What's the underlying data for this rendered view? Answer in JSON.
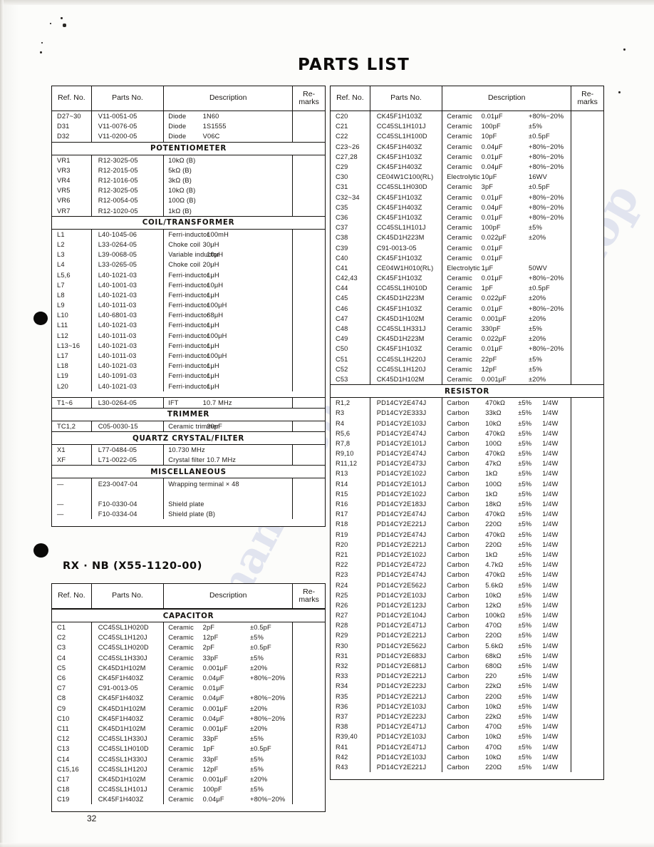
{
  "document": {
    "title": "PARTS LIST",
    "page_number": "32",
    "subtitle": "RX · NB  (X55-1120-00)"
  },
  "columns": {
    "ref": "Ref. No.",
    "part": "Parts No.",
    "desc": "Description",
    "remarks": "Re-\nmarks",
    "remarks_line1": "Re-",
    "remarks_line2": "marks"
  },
  "sections": {
    "potentiometer": "POTENTIOMETER",
    "coil_transformer": "COIL/TRANSFORMER",
    "trimmer": "TRIMMER",
    "quartz": "QUARTZ CRYSTAL/FILTER",
    "misc": "MISCELLANEOUS",
    "capacitor": "CAPACITOR",
    "resistor": "RESISTOR"
  },
  "left_table_1": {
    "diodes": [
      {
        "ref": "D27~30",
        "part": "V11-0051-05",
        "d1": "Diode",
        "d2": "1N60",
        "d3": "",
        "rem": ""
      },
      {
        "ref": "D31",
        "part": "V11-0076-05",
        "d1": "Diode",
        "d2": "1S1555",
        "d3": "",
        "rem": ""
      },
      {
        "ref": "D32",
        "part": "V11-0200-05",
        "d1": "Diode",
        "d2": "V06C",
        "d3": "",
        "rem": ""
      }
    ],
    "potentiometers": [
      {
        "ref": "VR1",
        "part": "R12-3025-05",
        "d1": "10kΩ (B)",
        "d2": "",
        "d3": "",
        "rem": ""
      },
      {
        "ref": "VR3",
        "part": "R12-2015-05",
        "d1": "5kΩ (B)",
        "d2": "",
        "d3": "",
        "rem": ""
      },
      {
        "ref": "VR4",
        "part": "R12-1016-05",
        "d1": "3kΩ (B)",
        "d2": "",
        "d3": "",
        "rem": ""
      },
      {
        "ref": "VR5",
        "part": "R12-3025-05",
        "d1": "10kΩ (B)",
        "d2": "",
        "d3": "",
        "rem": ""
      },
      {
        "ref": "VR6",
        "part": "R12-0054-05",
        "d1": "100Ω (B)",
        "d2": "",
        "d3": "",
        "rem": ""
      },
      {
        "ref": "VR7",
        "part": "R12-1020-05",
        "d1": "1kΩ (B)",
        "d2": "",
        "d3": "",
        "rem": ""
      }
    ],
    "coils": [
      {
        "ref": "L1",
        "part": "L40-1045-06",
        "d1": "Ferri-inductor",
        "d2": "100mH",
        "d3": "",
        "rem": ""
      },
      {
        "ref": "L2",
        "part": "L33-0264-05",
        "d1": "Choke coil",
        "d2": "30μH",
        "d3": "",
        "rem": ""
      },
      {
        "ref": "L3",
        "part": "L39-0068-05",
        "d1": "Variable inductor",
        "d2": "10μH",
        "d3": "",
        "rem": ""
      },
      {
        "ref": "L4",
        "part": "L33-0265-05",
        "d1": "Choke coil",
        "d2": "20μH",
        "d3": "",
        "rem": ""
      },
      {
        "ref": "L5,6",
        "part": "L40-1021-03",
        "d1": "Ferri-inductor",
        "d2": "1μH",
        "d3": "",
        "rem": ""
      },
      {
        "ref": "L7",
        "part": "L40-1001-03",
        "d1": "Ferri-inductor",
        "d2": "10μH",
        "d3": "",
        "rem": ""
      },
      {
        "ref": "L8",
        "part": "L40-1021-03",
        "d1": "Ferri-inductor",
        "d2": "1μH",
        "d3": "",
        "rem": ""
      },
      {
        "ref": "L9",
        "part": "L40-1011-03",
        "d1": "Ferri-inductor",
        "d2": "100μH",
        "d3": "",
        "rem": ""
      },
      {
        "ref": "L10",
        "part": "L40-6801-03",
        "d1": "Ferri-inductor",
        "d2": "68μH",
        "d3": "",
        "rem": ""
      },
      {
        "ref": "L11",
        "part": "L40-1021-03",
        "d1": "Ferri-inductor",
        "d2": "1μH",
        "d3": "",
        "rem": ""
      },
      {
        "ref": "L12",
        "part": "L40-1011-03",
        "d1": "Ferri-inductor",
        "d2": "100μH",
        "d3": "",
        "rem": ""
      },
      {
        "ref": "L13~16",
        "part": "L40-1021-03",
        "d1": "Ferri-inductor",
        "d2": "1μH",
        "d3": "",
        "rem": ""
      },
      {
        "ref": "L17",
        "part": "L40-1011-03",
        "d1": "Ferri-inductor",
        "d2": "100μH",
        "d3": "",
        "rem": ""
      },
      {
        "ref": "L18",
        "part": "L40-1021-03",
        "d1": "Ferri-inductor",
        "d2": "1μH",
        "d3": "",
        "rem": ""
      },
      {
        "ref": "L19",
        "part": "L40-1091-03",
        "d1": "Ferri-inductor",
        "d2": "1μH",
        "d3": "",
        "rem": ""
      },
      {
        "ref": "L20",
        "part": "L40-1021-03",
        "d1": "Ferri-inductor",
        "d2": "1μH",
        "d3": "",
        "rem": ""
      }
    ],
    "ift": [
      {
        "ref": "T1~6",
        "part": "L30-0264-05",
        "d1": "IFT",
        "d2": "10.7 MHz",
        "d3": "",
        "rem": ""
      }
    ],
    "trimmers": [
      {
        "ref": "TC1,2",
        "part": "C05-0030-15",
        "d1": "Ceramic trimmer",
        "d2": "20pF",
        "d3": "",
        "rem": ""
      }
    ],
    "quartz": [
      {
        "ref": "X1",
        "part": "L77-0484-05",
        "d1": "10.730 MHz",
        "d2": "",
        "d3": "",
        "rem": ""
      },
      {
        "ref": "XF",
        "part": "L71-0022-05",
        "d1": "Crystal filter 10.7 MHz",
        "d2": "",
        "d3": "",
        "rem": ""
      }
    ],
    "misc": [
      {
        "ref": "—",
        "part": "E23-0047-04",
        "d1": "Wrapping terminal × 48",
        "d2": "",
        "d3": "",
        "rem": ""
      },
      {
        "ref": "",
        "part": "",
        "d1": "",
        "d2": "",
        "d3": "",
        "rem": ""
      },
      {
        "ref": "—",
        "part": "F10-0330-04",
        "d1": "Shield plate",
        "d2": "",
        "d3": "",
        "rem": ""
      },
      {
        "ref": "—",
        "part": "F10-0334-04",
        "d1": "Shield plate (B)",
        "d2": "",
        "d3": "",
        "rem": ""
      }
    ]
  },
  "left_table_2": {
    "capacitors": [
      {
        "ref": "C1",
        "part": "CC45SL1H020D",
        "d1": "Ceramic",
        "d2": "2pF",
        "d3": "±0.5pF",
        "rem": ""
      },
      {
        "ref": "C2",
        "part": "CC45SL1H120J",
        "d1": "Ceramic",
        "d2": "12pF",
        "d3": "±5%",
        "rem": ""
      },
      {
        "ref": "C3",
        "part": "CC45SL1H020D",
        "d1": "Ceramic",
        "d2": "2pF",
        "d3": "±0.5pF",
        "rem": ""
      },
      {
        "ref": "C4",
        "part": "CC45SL1H330J",
        "d1": "Ceramic",
        "d2": "33pF",
        "d3": "±5%",
        "rem": ""
      },
      {
        "ref": "C5",
        "part": "CK45D1H102M",
        "d1": "Ceramic",
        "d2": "0.001μF",
        "d3": "±20%",
        "rem": ""
      },
      {
        "ref": "C6",
        "part": "CK45F1H403Z",
        "d1": "Ceramic",
        "d2": "0.04μF",
        "d3": "+80%−20%",
        "rem": ""
      },
      {
        "ref": "C7",
        "part": "C91-0013-05",
        "d1": "Ceramic",
        "d2": "0.01μF",
        "d3": "",
        "rem": ""
      },
      {
        "ref": "C8",
        "part": "CK45F1H403Z",
        "d1": "Ceramic",
        "d2": "0.04μF",
        "d3": "+80%−20%",
        "rem": ""
      },
      {
        "ref": "C9",
        "part": "CK45D1H102M",
        "d1": "Ceramic",
        "d2": "0.001μF",
        "d3": "±20%",
        "rem": ""
      },
      {
        "ref": "C10",
        "part": "CK45F1H403Z",
        "d1": "Ceramic",
        "d2": "0.04μF",
        "d3": "+80%−20%",
        "rem": ""
      },
      {
        "ref": "C11",
        "part": "CK45D1H102M",
        "d1": "Ceramic",
        "d2": "0.001μF",
        "d3": "±20%",
        "rem": ""
      },
      {
        "ref": "C12",
        "part": "CC45SL1H330J",
        "d1": "Ceramic",
        "d2": "33pF",
        "d3": "±5%",
        "rem": ""
      },
      {
        "ref": "C13",
        "part": "CC45SL1H010D",
        "d1": "Ceramic",
        "d2": "1pF",
        "d3": "±0.5pF",
        "rem": ""
      },
      {
        "ref": "C14",
        "part": "CC45SL1H330J",
        "d1": "Ceramic",
        "d2": "33pF",
        "d3": "±5%",
        "rem": ""
      },
      {
        "ref": "C15,16",
        "part": "CC45SL1H120J",
        "d1": "Ceramic",
        "d2": "12pF",
        "d3": "±5%",
        "rem": ""
      },
      {
        "ref": "C17",
        "part": "CK45D1H102M",
        "d1": "Ceramic",
        "d2": "0.001μF",
        "d3": "±20%",
        "rem": ""
      },
      {
        "ref": "C18",
        "part": "CC45SL1H101J",
        "d1": "Ceramic",
        "d2": "100pF",
        "d3": "±5%",
        "rem": ""
      },
      {
        "ref": "C19",
        "part": "CK45F1H403Z",
        "d1": "Ceramic",
        "d2": "0.04μF",
        "d3": "+80%−20%",
        "rem": ""
      }
    ]
  },
  "right_table": {
    "capacitors": [
      {
        "ref": "C20",
        "part": "CK45F1H103Z",
        "d1": "Ceramic",
        "d2": "0.01μF",
        "d3": "+80%−20%",
        "rem": ""
      },
      {
        "ref": "C21",
        "part": "CC45SL1H101J",
        "d1": "Ceramic",
        "d2": "100pF",
        "d3": "±5%",
        "rem": ""
      },
      {
        "ref": "C22",
        "part": "CC45SL1H100D",
        "d1": "Ceramic",
        "d2": "10pF",
        "d3": "±0.5pF",
        "rem": ""
      },
      {
        "ref": "C23~26",
        "part": "CK45F1H403Z",
        "d1": "Ceramic",
        "d2": "0.04μF",
        "d3": "+80%−20%",
        "rem": ""
      },
      {
        "ref": "C27,28",
        "part": "CK45F1H103Z",
        "d1": "Ceramic",
        "d2": "0.01μF",
        "d3": "+80%−20%",
        "rem": ""
      },
      {
        "ref": "C29",
        "part": "CK45F1H403Z",
        "d1": "Ceramic",
        "d2": "0.04μF",
        "d3": "+80%−20%",
        "rem": ""
      },
      {
        "ref": "C30",
        "part": "CE04W1C100(RL)",
        "d1": "Electrolytic",
        "d2": "10μF",
        "d3": "16WV",
        "rem": ""
      },
      {
        "ref": "C31",
        "part": "CC45SL1H030D",
        "d1": "Ceramic",
        "d2": "3pF",
        "d3": "±0.5pF",
        "rem": ""
      },
      {
        "ref": "C32~34",
        "part": "CK45F1H103Z",
        "d1": "Ceramic",
        "d2": "0.01μF",
        "d3": "+80%−20%",
        "rem": ""
      },
      {
        "ref": "C35",
        "part": "CK45F1H403Z",
        "d1": "Ceramic",
        "d2": "0.04μF",
        "d3": "+80%−20%",
        "rem": ""
      },
      {
        "ref": "C36",
        "part": "CK45F1H103Z",
        "d1": "Ceramic",
        "d2": "0.01μF",
        "d3": "+80%−20%",
        "rem": ""
      },
      {
        "ref": "C37",
        "part": "CC45SL1H101J",
        "d1": "Ceramic",
        "d2": "100pF",
        "d3": "±5%",
        "rem": ""
      },
      {
        "ref": "C38",
        "part": "CK45D1H223M",
        "d1": "Ceramic",
        "d2": "0.022μF",
        "d3": "±20%",
        "rem": ""
      },
      {
        "ref": "C39",
        "part": "C91-0013-05",
        "d1": "Ceramic",
        "d2": "0.01μF",
        "d3": "",
        "rem": ""
      },
      {
        "ref": "C40",
        "part": "CK45F1H103Z",
        "d1": "Ceramic",
        "d2": "0.01μF",
        "d3": "",
        "rem": ""
      },
      {
        "ref": "C41",
        "part": "CE04W1H010(RL)",
        "d1": "Electrolytic",
        "d2": "1μF",
        "d3": "50WV",
        "rem": ""
      },
      {
        "ref": "C42,43",
        "part": "CK45F1H103Z",
        "d1": "Ceramic",
        "d2": "0.01μF",
        "d3": "+80%−20%",
        "rem": ""
      },
      {
        "ref": "C44",
        "part": "CC45SL1H010D",
        "d1": "Ceramic",
        "d2": "1pF",
        "d3": "±0.5pF",
        "rem": ""
      },
      {
        "ref": "C45",
        "part": "CK45D1H223M",
        "d1": "Ceramic",
        "d2": "0.022μF",
        "d3": "±20%",
        "rem": ""
      },
      {
        "ref": "C46",
        "part": "CK45F1H103Z",
        "d1": "Ceramic",
        "d2": "0.01μF",
        "d3": "+80%−20%",
        "rem": ""
      },
      {
        "ref": "C47",
        "part": "CK45D1H102M",
        "d1": "Ceramic",
        "d2": "0.001μF",
        "d3": "±20%",
        "rem": ""
      },
      {
        "ref": "C48",
        "part": "CC45SL1H331J",
        "d1": "Ceramic",
        "d2": "330pF",
        "d3": "±5%",
        "rem": ""
      },
      {
        "ref": "C49",
        "part": "CK45D1H223M",
        "d1": "Ceramic",
        "d2": "0.022μF",
        "d3": "±20%",
        "rem": ""
      },
      {
        "ref": "C50",
        "part": "CK45F1H103Z",
        "d1": "Ceramic",
        "d2": "0.01μF",
        "d3": "+80%−20%",
        "rem": ""
      },
      {
        "ref": "C51",
        "part": "CC45SL1H220J",
        "d1": "Ceramic",
        "d2": "22pF",
        "d3": "±5%",
        "rem": ""
      },
      {
        "ref": "C52",
        "part": "CC45SL1H120J",
        "d1": "Ceramic",
        "d2": "12pF",
        "d3": "±5%",
        "rem": ""
      },
      {
        "ref": "C53",
        "part": "CK45D1H102M",
        "d1": "Ceramic",
        "d2": "0.001μF",
        "d3": "±20%",
        "rem": ""
      }
    ],
    "resistors": [
      {
        "ref": "R1,2",
        "part": "PD14CY2E474J",
        "d1": "Carbon",
        "d2": "470kΩ",
        "d3": "±5%",
        "d4": "1/4W",
        "rem": ""
      },
      {
        "ref": "R3",
        "part": "PD14CY2E333J",
        "d1": "Carbon",
        "d2": "33kΩ",
        "d3": "±5%",
        "d4": "1/4W",
        "rem": ""
      },
      {
        "ref": "R4",
        "part": "PD14CY2E103J",
        "d1": "Carbon",
        "d2": "10kΩ",
        "d3": "±5%",
        "d4": "1/4W",
        "rem": ""
      },
      {
        "ref": "R5,6",
        "part": "PD14CY2E474J",
        "d1": "Carbon",
        "d2": "470kΩ",
        "d3": "±5%",
        "d4": "1/4W",
        "rem": ""
      },
      {
        "ref": "R7,8",
        "part": "PD14CY2E101J",
        "d1": "Carbon",
        "d2": "100Ω",
        "d3": "±5%",
        "d4": "1/4W",
        "rem": ""
      },
      {
        "ref": "R9,10",
        "part": "PD14CY2E474J",
        "d1": "Carbon",
        "d2": "470kΩ",
        "d3": "±5%",
        "d4": "1/4W",
        "rem": ""
      },
      {
        "ref": "R11,12",
        "part": "PD14CY2E473J",
        "d1": "Carbon",
        "d2": "47kΩ",
        "d3": "±5%",
        "d4": "1/4W",
        "rem": ""
      },
      {
        "ref": "R13",
        "part": "PD14CY2E102J",
        "d1": "Carbon",
        "d2": "1kΩ",
        "d3": "±5%",
        "d4": "1/4W",
        "rem": ""
      },
      {
        "ref": "R14",
        "part": "PD14CY2E101J",
        "d1": "Carbon",
        "d2": "100Ω",
        "d3": "±5%",
        "d4": "1/4W",
        "rem": ""
      },
      {
        "ref": "R15",
        "part": "PD14CY2E102J",
        "d1": "Carbon",
        "d2": "1kΩ",
        "d3": "±5%",
        "d4": "1/4W",
        "rem": ""
      },
      {
        "ref": "R16",
        "part": "PD14CY2E183J",
        "d1": "Carbon",
        "d2": "18kΩ",
        "d3": "±5%",
        "d4": "1/4W",
        "rem": ""
      },
      {
        "ref": "R17",
        "part": "PD14CY2E474J",
        "d1": "Carbon",
        "d2": "470kΩ",
        "d3": "±5%",
        "d4": "1/4W",
        "rem": ""
      },
      {
        "ref": "R18",
        "part": "PD14CY2E221J",
        "d1": "Carbon",
        "d2": "220Ω",
        "d3": "±5%",
        "d4": "1/4W",
        "rem": ""
      },
      {
        "ref": "R19",
        "part": "PD14CY2E474J",
        "d1": "Carbon",
        "d2": "470kΩ",
        "d3": "±5%",
        "d4": "1/4W",
        "rem": ""
      },
      {
        "ref": "R20",
        "part": "PD14CY2E221J",
        "d1": "Carbon",
        "d2": "220Ω",
        "d3": "±5%",
        "d4": "1/4W",
        "rem": ""
      },
      {
        "ref": "R21",
        "part": "PD14CY2E102J",
        "d1": "Carbon",
        "d2": "1kΩ",
        "d3": "±5%",
        "d4": "1/4W",
        "rem": ""
      },
      {
        "ref": "R22",
        "part": "PD14CY2E472J",
        "d1": "Carbon",
        "d2": "4.7kΩ",
        "d3": "±5%",
        "d4": "1/4W",
        "rem": ""
      },
      {
        "ref": "R23",
        "part": "PD14CY2E474J",
        "d1": "Carbon",
        "d2": "470kΩ",
        "d3": "±5%",
        "d4": "1/4W",
        "rem": ""
      },
      {
        "ref": "R24",
        "part": "PD14CY2E562J",
        "d1": "Carbon",
        "d2": "5.6kΩ",
        "d3": "±5%",
        "d4": "1/4W",
        "rem": ""
      },
      {
        "ref": "R25",
        "part": "PD14CY2E103J",
        "d1": "Carbon",
        "d2": "10kΩ",
        "d3": "±5%",
        "d4": "1/4W",
        "rem": ""
      },
      {
        "ref": "R26",
        "part": "PD14CY2E123J",
        "d1": "Carbon",
        "d2": "12kΩ",
        "d3": "±5%",
        "d4": "1/4W",
        "rem": ""
      },
      {
        "ref": "R27",
        "part": "PD14CY2E104J",
        "d1": "Carbon",
        "d2": "100kΩ",
        "d3": "±5%",
        "d4": "1/4W",
        "rem": ""
      },
      {
        "ref": "R28",
        "part": "PD14CY2E471J",
        "d1": "Carbon",
        "d2": "470Ω",
        "d3": "±5%",
        "d4": "1/4W",
        "rem": ""
      },
      {
        "ref": "R29",
        "part": "PD14CY2E221J",
        "d1": "Carbon",
        "d2": "220Ω",
        "d3": "±5%",
        "d4": "1/4W",
        "rem": ""
      },
      {
        "ref": "R30",
        "part": "PD14CY2E562J",
        "d1": "Carbon",
        "d2": "5.6kΩ",
        "d3": "±5%",
        "d4": "1/4W",
        "rem": ""
      },
      {
        "ref": "R31",
        "part": "PD14CY2E683J",
        "d1": "Carbon",
        "d2": "68kΩ",
        "d3": "±5%",
        "d4": "1/4W",
        "rem": ""
      },
      {
        "ref": "R32",
        "part": "PD14CY2E681J",
        "d1": "Carbon",
        "d2": "680Ω",
        "d3": "±5%",
        "d4": "1/4W",
        "rem": ""
      },
      {
        "ref": "R33",
        "part": "PD14CY2E221J",
        "d1": "Carbon",
        "d2": "220",
        "d3": "±5%",
        "d4": "1/4W",
        "rem": ""
      },
      {
        "ref": "R34",
        "part": "PD14CY2E223J",
        "d1": "Carbon",
        "d2": "22kΩ",
        "d3": "±5%",
        "d4": "1/4W",
        "rem": ""
      },
      {
        "ref": "R35",
        "part": "PD14CY2E221J",
        "d1": "Carbon",
        "d2": "220Ω",
        "d3": "±5%",
        "d4": "1/4W",
        "rem": ""
      },
      {
        "ref": "R36",
        "part": "PD14CY2E103J",
        "d1": "Carbon",
        "d2": "10kΩ",
        "d3": "±5%",
        "d4": "1/4W",
        "rem": ""
      },
      {
        "ref": "R37",
        "part": "PD14CY2E223J",
        "d1": "Carbon",
        "d2": "22kΩ",
        "d3": "±5%",
        "d4": "1/4W",
        "rem": ""
      },
      {
        "ref": "R38",
        "part": "PD14CY2E471J",
        "d1": "Carbon",
        "d2": "470Ω",
        "d3": "±5%",
        "d4": "1/4W",
        "rem": ""
      },
      {
        "ref": "R39,40",
        "part": "PD14CY2E103J",
        "d1": "Carbon",
        "d2": "10kΩ",
        "d3": "±5%",
        "d4": "1/4W",
        "rem": ""
      },
      {
        "ref": "R41",
        "part": "PD14CY2E471J",
        "d1": "Carbon",
        "d2": "470Ω",
        "d3": "±5%",
        "d4": "1/4W",
        "rem": ""
      },
      {
        "ref": "R42",
        "part": "PD14CY2E103J",
        "d1": "Carbon",
        "d2": "10kΩ",
        "d3": "±5%",
        "d4": "1/4W",
        "rem": ""
      },
      {
        "ref": "R43",
        "part": "PD14CY2E221J",
        "d1": "Carbon",
        "d2": "220Ω",
        "d3": "±5%",
        "d4": "1/4W",
        "rem": ""
      }
    ]
  },
  "watermark": {
    "text": "manualshop"
  }
}
